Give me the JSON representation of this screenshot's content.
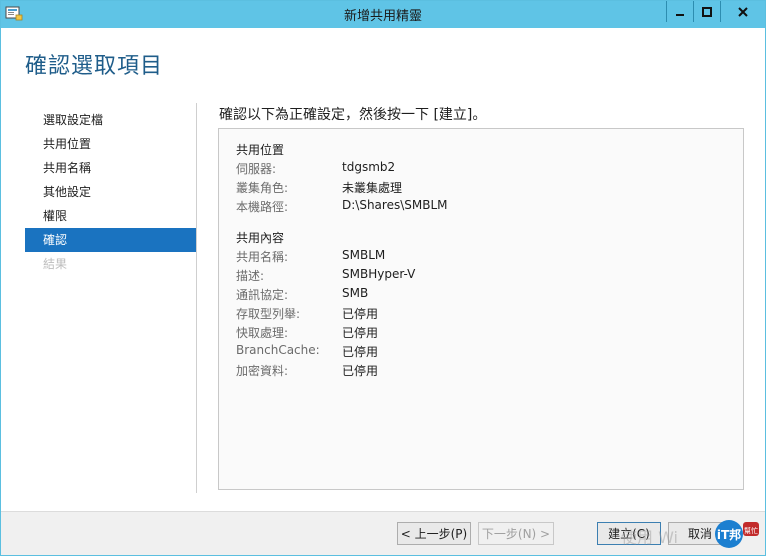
{
  "window": {
    "title": "新增共用精靈",
    "controls": {
      "minimize": "minimize-icon",
      "maximize": "maximize-icon",
      "close": "close-icon"
    }
  },
  "page_title": "確認選取項目",
  "sidebar": {
    "items": [
      {
        "label": "選取設定檔",
        "state": "normal"
      },
      {
        "label": "共用位置",
        "state": "normal"
      },
      {
        "label": "共用名稱",
        "state": "normal"
      },
      {
        "label": "其他設定",
        "state": "normal"
      },
      {
        "label": "權限",
        "state": "normal"
      },
      {
        "label": "確認",
        "state": "active"
      },
      {
        "label": "結果",
        "state": "disabled"
      }
    ]
  },
  "instruction": "確認以下為正確設定，然後按一下 [建立]。",
  "summary": {
    "location_section": {
      "heading": "共用位置",
      "rows": [
        {
          "label": "伺服器:",
          "value": "tdgsmb2"
        },
        {
          "label": "叢集角色:",
          "value": "未叢集處理"
        },
        {
          "label": "本機路徑:",
          "value": "D:\\Shares\\SMBLM"
        }
      ]
    },
    "content_section": {
      "heading": "共用內容",
      "rows": [
        {
          "label": "共用名稱:",
          "value": "SMBLM"
        },
        {
          "label": "描述:",
          "value": "SMBHyper-V"
        },
        {
          "label": "通訊協定:",
          "value": "SMB"
        },
        {
          "label": "存取型列舉:",
          "value": "已停用"
        },
        {
          "label": "快取處理:",
          "value": "已停用"
        },
        {
          "label": "BranchCache:",
          "value": "已停用"
        },
        {
          "label": "加密資料:",
          "value": "已停用"
        }
      ]
    }
  },
  "footer": {
    "back_label": "< 上一步(P)",
    "next_label": "下一步(N) >",
    "create_label": "建立(C)",
    "cancel_label": "取消"
  },
  "watermark": {
    "logo_text": "iT邦",
    "sub_text": "幫忙",
    "faded_text": "使用 Wi"
  },
  "colors": {
    "titlebar": "#5fc4e6",
    "accent": "#1a73c0",
    "page_title": "#1f5d8a"
  }
}
